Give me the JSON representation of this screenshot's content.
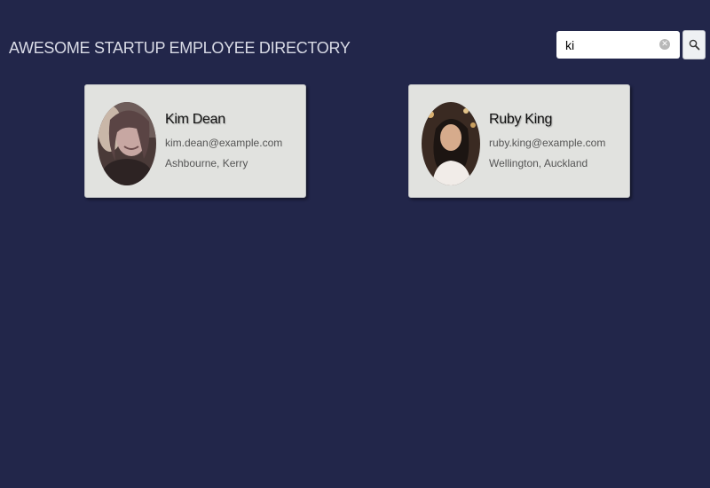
{
  "header": {
    "title": "AWESOME STARTUP EMPLOYEE DIRECTORY"
  },
  "search": {
    "value": "ki",
    "clear_icon": "clear-icon",
    "button_icon": "search-icon"
  },
  "employees": [
    {
      "name": "Kim Dean",
      "email": "kim.dean@example.com",
      "location": "Ashbourne, Kerry"
    },
    {
      "name": "Ruby King",
      "email": "ruby.king@example.com",
      "location": "Wellington, Auckland"
    }
  ],
  "colors": {
    "background": "#22264a",
    "card": "#e1e2df",
    "title": "#d9dbe6"
  }
}
